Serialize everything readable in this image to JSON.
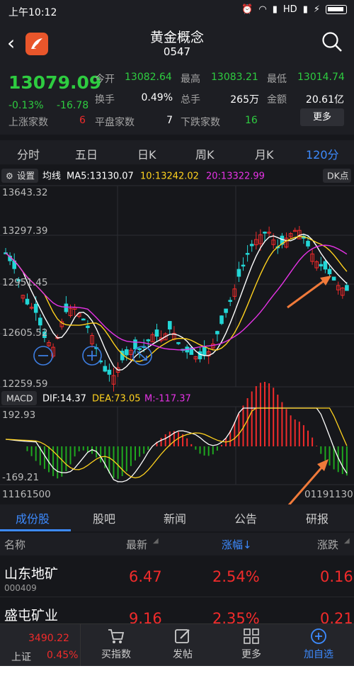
{
  "status": {
    "time": "上午10:12",
    "network": "HD"
  },
  "header": {
    "title": "黄金概念",
    "code": "0547"
  },
  "quote": {
    "price": "13079.09",
    "change_pct": "-0.13%",
    "change": "-16.78",
    "open_label": "今开",
    "open": "13082.64",
    "high_label": "最高",
    "high": "13083.21",
    "low_label": "最低",
    "low": "13014.74",
    "turnover_label": "换手",
    "turnover": "0.49%",
    "volume_label": "总手",
    "volume": "265万",
    "amount_label": "金额",
    "amount": "20.61亿",
    "up_label": "上涨家数",
    "up": "6",
    "flat_label": "平盘家数",
    "flat": "7",
    "down_label": "下跌家数",
    "down": "16",
    "more_label": "更多"
  },
  "periods": [
    "分时",
    "五日",
    "日K",
    "周K",
    "月K",
    "120分"
  ],
  "chart": {
    "settings_label": "设置",
    "ma_label": "均线",
    "ma5": "MA5:13130.07",
    "ma10": "10:13242.02",
    "ma20": "20:13322.99",
    "dk_label": "DK点",
    "y_ticks": [
      "13643.32",
      "13297.39",
      "12951.45",
      "12605.52",
      "12259.59"
    ],
    "macd_label": "MACD",
    "dif": "DIF:14.37",
    "dea": "DEA:73.05",
    "m": "M:-117.37",
    "macd_top": "192.93",
    "macd_bottom": "-169.21",
    "date_left": "11161500",
    "date_right": "01191130",
    "colors": {
      "up": "#f02b2b",
      "down": "#23d6d6",
      "ma5": "#ffffff",
      "ma10": "#ffd21e",
      "ma20": "#e633e6",
      "arrow": "#f07a3a"
    }
  },
  "tabs": [
    "成份股",
    "股吧",
    "新闻",
    "公告",
    "研报"
  ],
  "list": {
    "headers": [
      "名称",
      "最新",
      "涨幅↓",
      "涨跌"
    ],
    "rows": [
      {
        "name": "山东地矿",
        "code": "000409",
        "latest": "6.47",
        "pct": "2.54%",
        "chg": "0.16"
      },
      {
        "name": "盛屯矿业",
        "code": "",
        "latest": "9.16",
        "pct": "2.35%",
        "chg": "0.21"
      }
    ]
  },
  "bottom": {
    "index_value": "3490.22",
    "index_name": "上证",
    "index_pct": "0.45%",
    "items": [
      "买指数",
      "发帖",
      "更多",
      "加自选"
    ]
  }
}
